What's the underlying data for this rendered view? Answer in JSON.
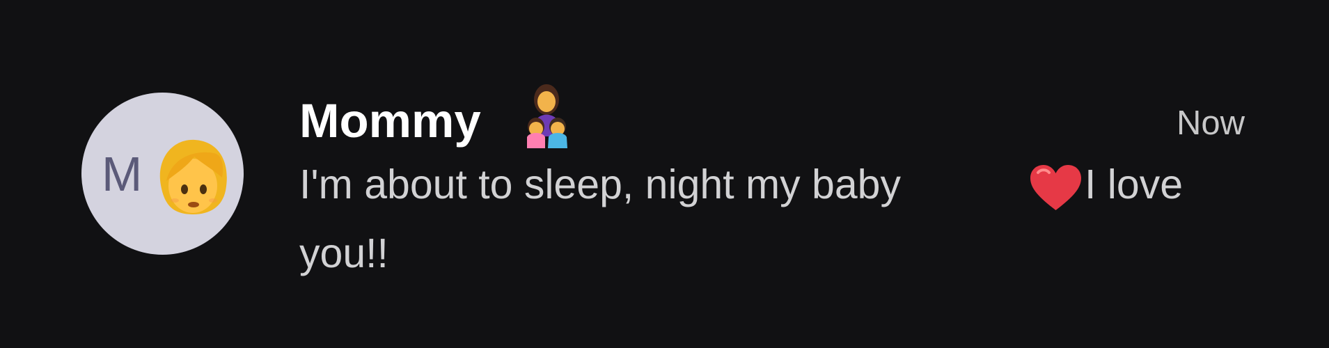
{
  "notification": {
    "avatar_initial": "M",
    "sender": "Mommy",
    "timestamp": "Now",
    "message_part_1": "I'm about to sleep, night my baby",
    "message_part_2": "I love",
    "message_line_2": "you!!",
    "icons": {
      "avatar_emoji": "woman-emoji-icon",
      "name_emoji": "family-mother-children-icon",
      "message_emoji": "red-heart-icon"
    }
  },
  "colors": {
    "background": "#111113",
    "avatar_background": "#d4d3df",
    "avatar_initial": "#5b5a79",
    "name": "#ffffff",
    "message": "#d2d2d4",
    "heart": "#e63946"
  }
}
